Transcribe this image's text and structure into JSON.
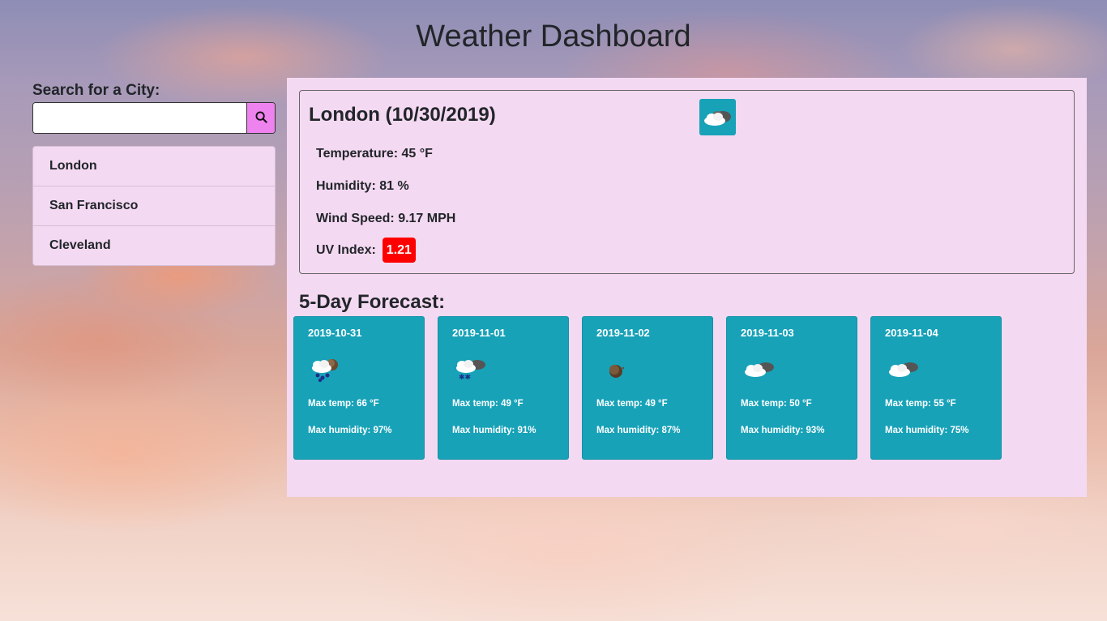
{
  "page": {
    "title": "Weather Dashboard"
  },
  "search": {
    "label": "Search for a City:",
    "value": "",
    "placeholder": "",
    "button_icon": "search-icon"
  },
  "history": {
    "items": [
      {
        "label": "London"
      },
      {
        "label": "San Francisco"
      },
      {
        "label": "Cleveland"
      }
    ]
  },
  "current": {
    "title": "London (10/30/2019)",
    "icon": "cloudy-icon",
    "temperature": "Temperature: 45 °F",
    "humidity": "Humidity: 81 %",
    "wind": "Wind Speed: 9.17 MPH",
    "uv_label": "UV Index:",
    "uv_value": "1.21",
    "uv_color": "#ff0000"
  },
  "forecast": {
    "title": "5-Day Forecast:",
    "days": [
      {
        "date": "2019-10-31",
        "icon": "rain-night-icon",
        "max_temp": "Max temp: 66 °F",
        "max_humidity": "Max humidity: 97%"
      },
      {
        "date": "2019-11-01",
        "icon": "snow-night-icon",
        "max_temp": "Max temp: 49 °F",
        "max_humidity": "Max humidity: 91%"
      },
      {
        "date": "2019-11-02",
        "icon": "clear-night-icon",
        "max_temp": "Max temp: 49 °F",
        "max_humidity": "Max humidity: 87%"
      },
      {
        "date": "2019-11-03",
        "icon": "cloudy-night-icon",
        "max_temp": "Max temp: 50 °F",
        "max_humidity": "Max humidity: 93%"
      },
      {
        "date": "2019-11-04",
        "icon": "cloudy-night-icon",
        "max_temp": "Max temp: 55 °F",
        "max_humidity": "Max humidity: 75%"
      }
    ]
  },
  "colors": {
    "panel": "#f4d9f2",
    "forecast_card": "#17a2b8",
    "search_button": "#ee82ee",
    "uv_badge": "#ff0000"
  }
}
